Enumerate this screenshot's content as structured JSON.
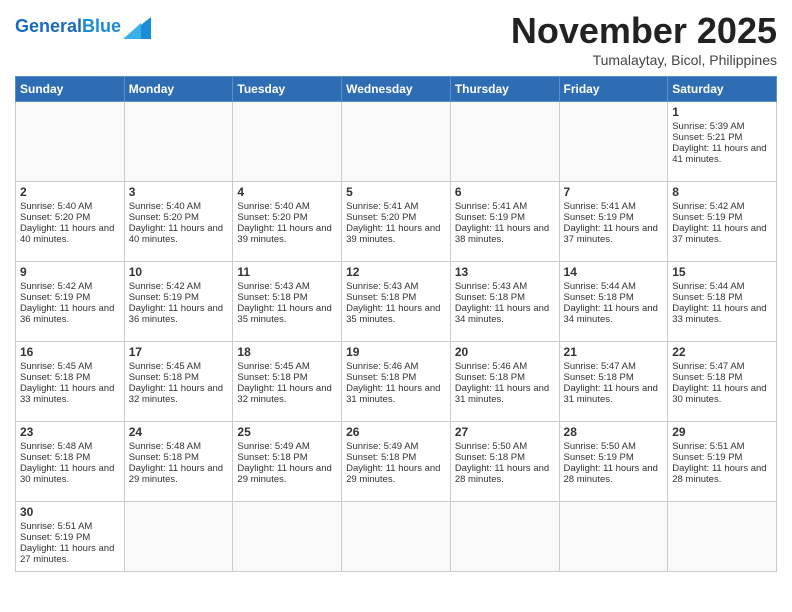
{
  "header": {
    "logo_general": "General",
    "logo_blue": "Blue",
    "month_year": "November 2025",
    "location": "Tumalaytay, Bicol, Philippines"
  },
  "weekdays": [
    "Sunday",
    "Monday",
    "Tuesday",
    "Wednesday",
    "Thursday",
    "Friday",
    "Saturday"
  ],
  "weeks": [
    [
      {
        "day": "",
        "sunrise": "",
        "sunset": "",
        "daylight": ""
      },
      {
        "day": "",
        "sunrise": "",
        "sunset": "",
        "daylight": ""
      },
      {
        "day": "",
        "sunrise": "",
        "sunset": "",
        "daylight": ""
      },
      {
        "day": "",
        "sunrise": "",
        "sunset": "",
        "daylight": ""
      },
      {
        "day": "",
        "sunrise": "",
        "sunset": "",
        "daylight": ""
      },
      {
        "day": "",
        "sunrise": "",
        "sunset": "",
        "daylight": ""
      },
      {
        "day": "1",
        "sunrise": "Sunrise: 5:39 AM",
        "sunset": "Sunset: 5:21 PM",
        "daylight": "Daylight: 11 hours and 41 minutes."
      }
    ],
    [
      {
        "day": "2",
        "sunrise": "Sunrise: 5:40 AM",
        "sunset": "Sunset: 5:20 PM",
        "daylight": "Daylight: 11 hours and 40 minutes."
      },
      {
        "day": "3",
        "sunrise": "Sunrise: 5:40 AM",
        "sunset": "Sunset: 5:20 PM",
        "daylight": "Daylight: 11 hours and 40 minutes."
      },
      {
        "day": "4",
        "sunrise": "Sunrise: 5:40 AM",
        "sunset": "Sunset: 5:20 PM",
        "daylight": "Daylight: 11 hours and 39 minutes."
      },
      {
        "day": "5",
        "sunrise": "Sunrise: 5:41 AM",
        "sunset": "Sunset: 5:20 PM",
        "daylight": "Daylight: 11 hours and 39 minutes."
      },
      {
        "day": "6",
        "sunrise": "Sunrise: 5:41 AM",
        "sunset": "Sunset: 5:19 PM",
        "daylight": "Daylight: 11 hours and 38 minutes."
      },
      {
        "day": "7",
        "sunrise": "Sunrise: 5:41 AM",
        "sunset": "Sunset: 5:19 PM",
        "daylight": "Daylight: 11 hours and 37 minutes."
      },
      {
        "day": "8",
        "sunrise": "Sunrise: 5:42 AM",
        "sunset": "Sunset: 5:19 PM",
        "daylight": "Daylight: 11 hours and 37 minutes."
      }
    ],
    [
      {
        "day": "9",
        "sunrise": "Sunrise: 5:42 AM",
        "sunset": "Sunset: 5:19 PM",
        "daylight": "Daylight: 11 hours and 36 minutes."
      },
      {
        "day": "10",
        "sunrise": "Sunrise: 5:42 AM",
        "sunset": "Sunset: 5:19 PM",
        "daylight": "Daylight: 11 hours and 36 minutes."
      },
      {
        "day": "11",
        "sunrise": "Sunrise: 5:43 AM",
        "sunset": "Sunset: 5:18 PM",
        "daylight": "Daylight: 11 hours and 35 minutes."
      },
      {
        "day": "12",
        "sunrise": "Sunrise: 5:43 AM",
        "sunset": "Sunset: 5:18 PM",
        "daylight": "Daylight: 11 hours and 35 minutes."
      },
      {
        "day": "13",
        "sunrise": "Sunrise: 5:43 AM",
        "sunset": "Sunset: 5:18 PM",
        "daylight": "Daylight: 11 hours and 34 minutes."
      },
      {
        "day": "14",
        "sunrise": "Sunrise: 5:44 AM",
        "sunset": "Sunset: 5:18 PM",
        "daylight": "Daylight: 11 hours and 34 minutes."
      },
      {
        "day": "15",
        "sunrise": "Sunrise: 5:44 AM",
        "sunset": "Sunset: 5:18 PM",
        "daylight": "Daylight: 11 hours and 33 minutes."
      }
    ],
    [
      {
        "day": "16",
        "sunrise": "Sunrise: 5:45 AM",
        "sunset": "Sunset: 5:18 PM",
        "daylight": "Daylight: 11 hours and 33 minutes."
      },
      {
        "day": "17",
        "sunrise": "Sunrise: 5:45 AM",
        "sunset": "Sunset: 5:18 PM",
        "daylight": "Daylight: 11 hours and 32 minutes."
      },
      {
        "day": "18",
        "sunrise": "Sunrise: 5:45 AM",
        "sunset": "Sunset: 5:18 PM",
        "daylight": "Daylight: 11 hours and 32 minutes."
      },
      {
        "day": "19",
        "sunrise": "Sunrise: 5:46 AM",
        "sunset": "Sunset: 5:18 PM",
        "daylight": "Daylight: 11 hours and 31 minutes."
      },
      {
        "day": "20",
        "sunrise": "Sunrise: 5:46 AM",
        "sunset": "Sunset: 5:18 PM",
        "daylight": "Daylight: 11 hours and 31 minutes."
      },
      {
        "day": "21",
        "sunrise": "Sunrise: 5:47 AM",
        "sunset": "Sunset: 5:18 PM",
        "daylight": "Daylight: 11 hours and 31 minutes."
      },
      {
        "day": "22",
        "sunrise": "Sunrise: 5:47 AM",
        "sunset": "Sunset: 5:18 PM",
        "daylight": "Daylight: 11 hours and 30 minutes."
      }
    ],
    [
      {
        "day": "23",
        "sunrise": "Sunrise: 5:48 AM",
        "sunset": "Sunset: 5:18 PM",
        "daylight": "Daylight: 11 hours and 30 minutes."
      },
      {
        "day": "24",
        "sunrise": "Sunrise: 5:48 AM",
        "sunset": "Sunset: 5:18 PM",
        "daylight": "Daylight: 11 hours and 29 minutes."
      },
      {
        "day": "25",
        "sunrise": "Sunrise: 5:49 AM",
        "sunset": "Sunset: 5:18 PM",
        "daylight": "Daylight: 11 hours and 29 minutes."
      },
      {
        "day": "26",
        "sunrise": "Sunrise: 5:49 AM",
        "sunset": "Sunset: 5:18 PM",
        "daylight": "Daylight: 11 hours and 29 minutes."
      },
      {
        "day": "27",
        "sunrise": "Sunrise: 5:50 AM",
        "sunset": "Sunset: 5:18 PM",
        "daylight": "Daylight: 11 hours and 28 minutes."
      },
      {
        "day": "28",
        "sunrise": "Sunrise: 5:50 AM",
        "sunset": "Sunset: 5:19 PM",
        "daylight": "Daylight: 11 hours and 28 minutes."
      },
      {
        "day": "29",
        "sunrise": "Sunrise: 5:51 AM",
        "sunset": "Sunset: 5:19 PM",
        "daylight": "Daylight: 11 hours and 28 minutes."
      }
    ],
    [
      {
        "day": "30",
        "sunrise": "Sunrise: 5:51 AM",
        "sunset": "Sunset: 5:19 PM",
        "daylight": "Daylight: 11 hours and 27 minutes."
      },
      {
        "day": "",
        "sunrise": "",
        "sunset": "",
        "daylight": ""
      },
      {
        "day": "",
        "sunrise": "",
        "sunset": "",
        "daylight": ""
      },
      {
        "day": "",
        "sunrise": "",
        "sunset": "",
        "daylight": ""
      },
      {
        "day": "",
        "sunrise": "",
        "sunset": "",
        "daylight": ""
      },
      {
        "day": "",
        "sunrise": "",
        "sunset": "",
        "daylight": ""
      },
      {
        "day": "",
        "sunrise": "",
        "sunset": "",
        "daylight": ""
      }
    ]
  ]
}
